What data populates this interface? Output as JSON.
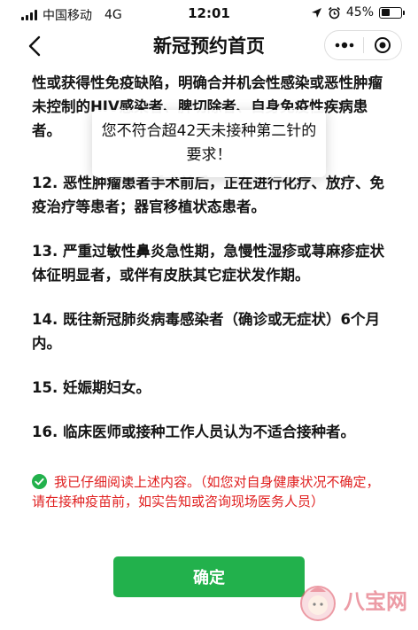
{
  "status_bar": {
    "carrier": "中国移动",
    "network": "4G",
    "time": "12:01",
    "battery": "45%",
    "battery_level": 0.45
  },
  "nav": {
    "title": "新冠预约首页"
  },
  "content": {
    "partial_paragraph": "性或获得性免疫缺陷，明确合并机会性感染或恶性肿瘤未控制的HIV感染者、脾切除者、自身免疫性疾病患者。",
    "items": [
      "12. 恶性肿瘤患者手术前后，正在进行化疗、放疗、免疫治疗等患者；器官移植状态患者。",
      "13. 严重过敏性鼻炎急性期，急慢性湿疹或荨麻疹症状体征明显者，或伴有皮肤其它症状发作期。",
      "14. 既往新冠肺炎病毒感染者（确诊或无症状）6个月内。",
      "15. 妊娠期妇女。",
      "16. 临床医师或接种工作人员认为不适合接种者。"
    ]
  },
  "consent": {
    "text": "我已仔细阅读上述内容。（如您对自身健康状况不确定，请在接种疫苗前，如实告知或咨询现场医务人员）"
  },
  "confirm_button": {
    "label": "确定"
  },
  "toast": {
    "message": "您不符合超42天未接种第二针的要求！"
  },
  "watermark": {
    "text": "八宝网"
  },
  "colors": {
    "accent_green": "#22b14c",
    "warning_red": "#e02020"
  }
}
